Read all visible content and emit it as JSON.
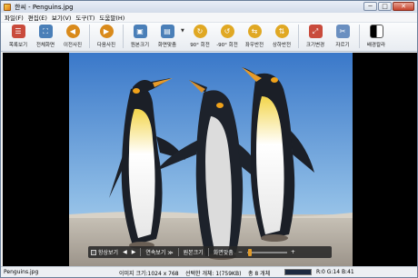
{
  "window": {
    "title": "한씨 - Penguins.jpg",
    "controls": {
      "minimize": "─",
      "maximize": "□",
      "close": "✕"
    }
  },
  "menu": [
    "파일(F)",
    "편집(E)",
    "보기(V)",
    "도구(T)",
    "도움말(H)"
  ],
  "toolbar": {
    "buttons": [
      {
        "label": "목록보기",
        "icon": "list-icon",
        "color": "#c94b3c"
      },
      {
        "label": "전체화면",
        "icon": "fullscreen-icon",
        "color": "#4a7fb8"
      },
      {
        "label": "이전사진",
        "icon": "prev-photo-icon",
        "color": "#d98a1b"
      },
      {
        "label": "다음사진",
        "icon": "next-photo-icon",
        "color": "#d98a1b"
      },
      {
        "label": "원본크기",
        "icon": "original-size-icon",
        "color": "#4a7fb8"
      },
      {
        "label": "화면맞춤",
        "icon": "fit-screen-icon",
        "color": "#4a7fb8"
      },
      {
        "label": "90° 회전",
        "icon": "rotate-cw-icon",
        "color": "#e0a823"
      },
      {
        "label": "-90° 회전",
        "icon": "rotate-ccw-icon",
        "color": "#e0a823"
      },
      {
        "label": "좌우반전",
        "icon": "flip-horizontal-icon",
        "color": "#e0a823"
      },
      {
        "label": "상하반전",
        "icon": "flip-vertical-icon",
        "color": "#e0a823"
      },
      {
        "label": "크기변경",
        "icon": "resize-icon",
        "color": "#c94b3c"
      },
      {
        "label": "자르기",
        "icon": "crop-icon",
        "color": "#6a8fc0"
      },
      {
        "label": "배경칼라",
        "icon": "background-color-icon",
        "color": "#333333"
      }
    ]
  },
  "viewer_controls": {
    "always_show": "항상보기",
    "slideshow": "연속보기 ≫",
    "original_size": "원본크기",
    "fit_screen": "화면맞춤",
    "minus": "−",
    "plus": "+"
  },
  "status": {
    "filename": "Penguins.jpg",
    "image_size": "이미지 크기:1024 x 768",
    "selected": "선택한 개체: 1(759KB)",
    "total": "총 8 개체",
    "color_readout": "R:0 G:14 B:41",
    "color_swatch": "#1c2a40"
  }
}
